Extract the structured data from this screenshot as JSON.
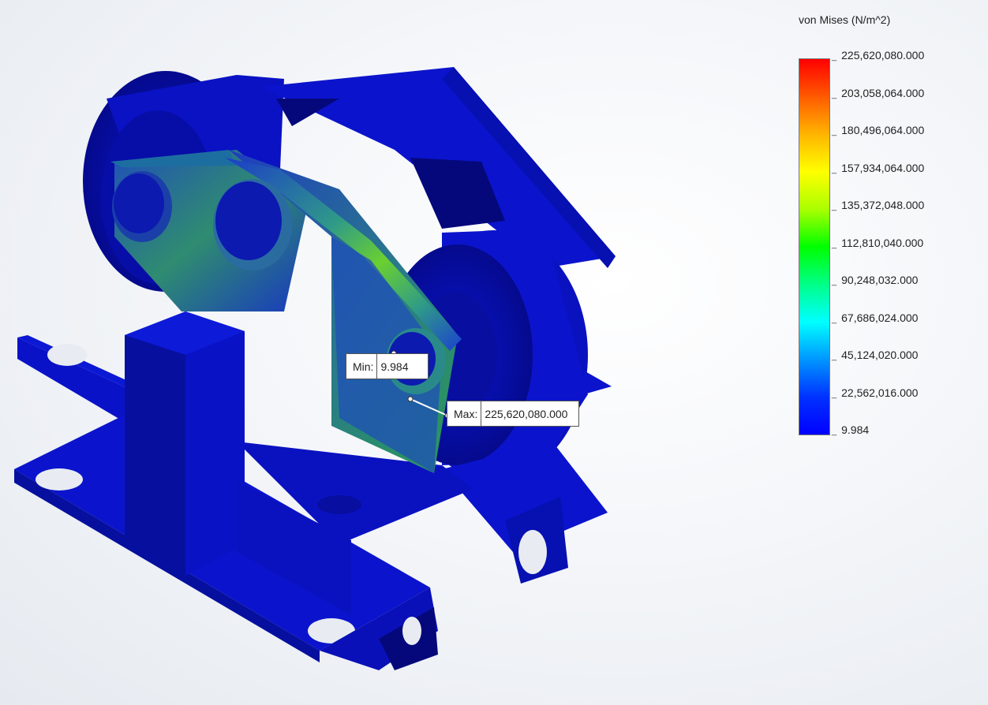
{
  "legend": {
    "title": "von Mises (N/m^2)",
    "ticks": [
      "225,620,080.000",
      "203,058,064.000",
      "180,496,064.000",
      "157,934,064.000",
      "135,372,048.000",
      "112,810,040.000",
      "90,248,032.000",
      "67,686,024.000",
      "45,124,020.000",
      "22,562,016.000",
      "9.984"
    ]
  },
  "probes": {
    "min": {
      "label": "Min:",
      "value": "9.984"
    },
    "max": {
      "label": "Max:",
      "value": "225,620,080.000"
    }
  },
  "colors": {
    "part_blue": "#0a10c8",
    "part_dark": "#060890",
    "stress_green": "#2fb060",
    "stress_yellow": "#d8e020"
  }
}
